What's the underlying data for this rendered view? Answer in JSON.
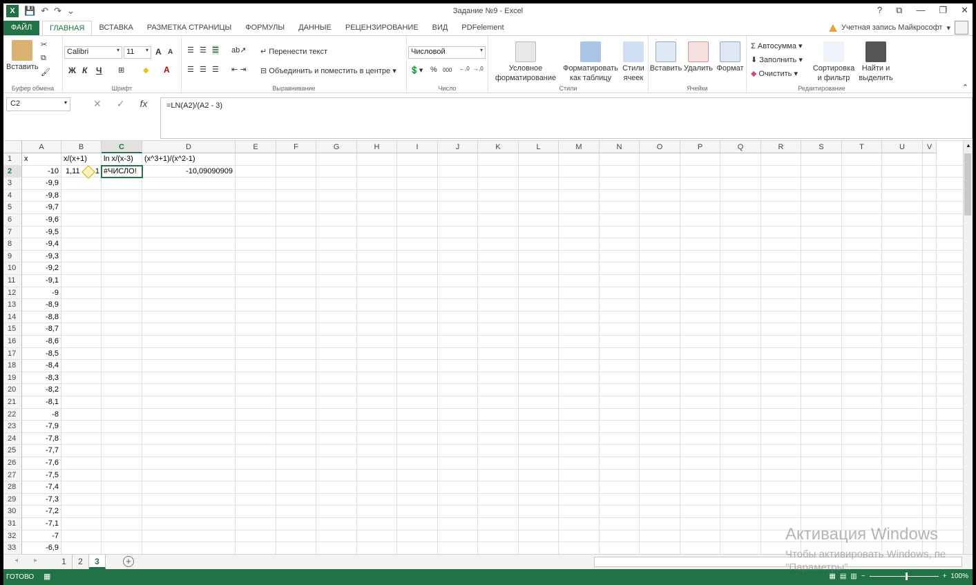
{
  "window": {
    "title": "Задание №9 - Excel",
    "help": "?",
    "buttons": [
      "⧉",
      "—",
      "❐",
      "✕"
    ]
  },
  "tabs": [
    "ФАЙЛ",
    "ГЛАВНАЯ",
    "ВСТАВКА",
    "РАЗМЕТКА СТРАНИЦЫ",
    "ФОРМУЛЫ",
    "ДАННЫЕ",
    "РЕЦЕНЗИРОВАНИЕ",
    "ВИД",
    "PDFelement"
  ],
  "account": "Учетная запись Майкрософт",
  "ribbon": {
    "clipboard": {
      "paste": "Вставить",
      "label": "Буфер обмена"
    },
    "font": {
      "name": "Calibri",
      "size": "11",
      "bold": "Ж",
      "italic": "К",
      "underline": "Ч",
      "grow": "A",
      "shrink": "A",
      "color": "A",
      "label": "Шрифт"
    },
    "alignment": {
      "wrap": "Перенести текст",
      "merge": "Объединить и поместить в центре",
      "label": "Выравнивание"
    },
    "number": {
      "format": "Числовой",
      "percent": "%",
      "thousands": "000",
      "inc": ",0 ,00",
      "dec": ",00 ,0",
      "label": "Число"
    },
    "styles": {
      "conditional": "Условное\nформатирование",
      "table": "Форматировать\nкак таблицу",
      "cell": "Стили\nячеек",
      "label": "Стили"
    },
    "cells": {
      "insert": "Вставить",
      "delete": "Удалить",
      "format": "Формат",
      "label": "Ячейки"
    },
    "editing": {
      "autosum": "Автосумма",
      "fill": "Заполнить",
      "clear": "Очистить",
      "sort": "Сортировка\nи фильтр",
      "find": "Найти и\nвыделить",
      "label": "Редактирование"
    }
  },
  "formula_bar": {
    "name_box": "C2",
    "formula": "=LN(A2)/(A2 - 3)",
    "fx": "fx"
  },
  "columns": [
    "A",
    "B",
    "C",
    "D",
    "E",
    "F",
    "G",
    "H",
    "I",
    "J",
    "K",
    "L",
    "M",
    "N",
    "O",
    "P",
    "Q",
    "R",
    "S",
    "T",
    "U",
    "V"
  ],
  "header_row": {
    "a": "x",
    "b": "x/(x+1)",
    "c": "ln x/(x-3)",
    "d": "(x^3+1)/(x^2-1)"
  },
  "row2": {
    "b": "1,11",
    "b2": "1",
    "c": "#ЧИСЛО!",
    "d": "-10,09090909"
  },
  "col_a_values": [
    "-10",
    "-9,9",
    "-9,8",
    "-9,7",
    "-9,6",
    "-9,5",
    "-9,4",
    "-9,3",
    "-9,2",
    "-9,1",
    "-9",
    "-8,9",
    "-8,8",
    "-8,7",
    "-8,6",
    "-8,5",
    "-8,4",
    "-8,3",
    "-8,2",
    "-8,1",
    "-8",
    "-7,9",
    "-7,8",
    "-7,7",
    "-7,6",
    "-7,5",
    "-7,4",
    "-7,3",
    "-7,2",
    "-7,1",
    "-7",
    "-6,9"
  ],
  "sheets": [
    "1",
    "2",
    "3"
  ],
  "active_sheet": "3",
  "status": {
    "mode": "ГОТОВО",
    "zoom": "100%"
  },
  "watermark": {
    "line1": "Активация Windows",
    "line2": "Чтобы активировать Windows, пе",
    "line3": "\"Параметры\"."
  }
}
